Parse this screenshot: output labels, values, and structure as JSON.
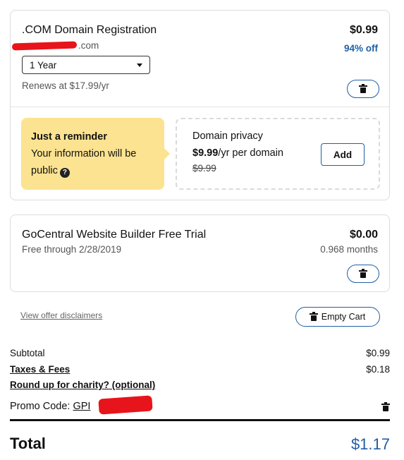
{
  "domain_item": {
    "title": ".COM Domain Registration",
    "domain_suffix": ".com",
    "price": "$0.99",
    "discount": "94% off",
    "term_selected": "1 Year",
    "renews": "Renews at $17.99/yr"
  },
  "reminder": {
    "title": "Just a reminder",
    "body": "Your information will be public"
  },
  "privacy": {
    "title": "Domain privacy",
    "price": "$9.99",
    "price_suffix": "/yr per domain",
    "old_price": "$9.99",
    "add_label": "Add"
  },
  "website_item": {
    "title": "GoCentral Website Builder Free Trial",
    "sub": "Free through 2/28/2019",
    "price": "$0.00",
    "duration": "0.968 months"
  },
  "footer": {
    "disclaimer_link": "View offer disclaimers",
    "empty_cart_label": "Empty Cart"
  },
  "summary": {
    "subtotal_label": "Subtotal",
    "subtotal_value": "$0.99",
    "taxes_label": "Taxes & Fees",
    "taxes_value": "$0.18",
    "charity_label": "Round up for charity? (optional)",
    "promo_label": "Promo Code:",
    "promo_code": "GPI",
    "total_label": "Total",
    "total_value": "$1.17"
  },
  "colors": {
    "accent_blue": "#1f5fa6",
    "reminder_yellow": "#fce391",
    "redaction_red": "#e8141b"
  }
}
